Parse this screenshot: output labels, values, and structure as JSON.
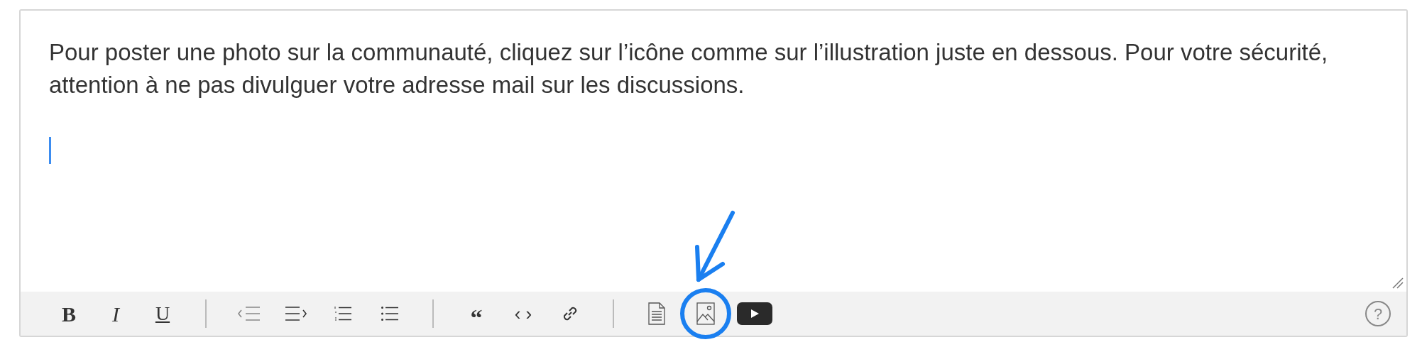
{
  "editor": {
    "text": "Pour poster une photo sur la communauté, cliquez sur l’icône comme sur l’illustration juste en dessous. Pour votre sécurité, attention à ne pas divulguer votre adresse mail sur les discussions.",
    "caret": true
  },
  "toolbar": {
    "groups": [
      [
        {
          "kind": "bold",
          "label": "B"
        },
        {
          "kind": "italic",
          "label": "I"
        },
        {
          "kind": "underline",
          "label": "U"
        }
      ],
      [
        {
          "kind": "outdent"
        },
        {
          "kind": "indent"
        },
        {
          "kind": "numbered-list"
        },
        {
          "kind": "bullet-list"
        }
      ],
      [
        {
          "kind": "quote",
          "label": "“"
        },
        {
          "kind": "code",
          "label": "‹ ›"
        },
        {
          "kind": "link"
        }
      ],
      [
        {
          "kind": "document",
          "highlighted": false
        },
        {
          "kind": "image",
          "highlighted": true
        },
        {
          "kind": "video",
          "highlighted": false
        }
      ]
    ],
    "help": {
      "label": "?"
    }
  }
}
